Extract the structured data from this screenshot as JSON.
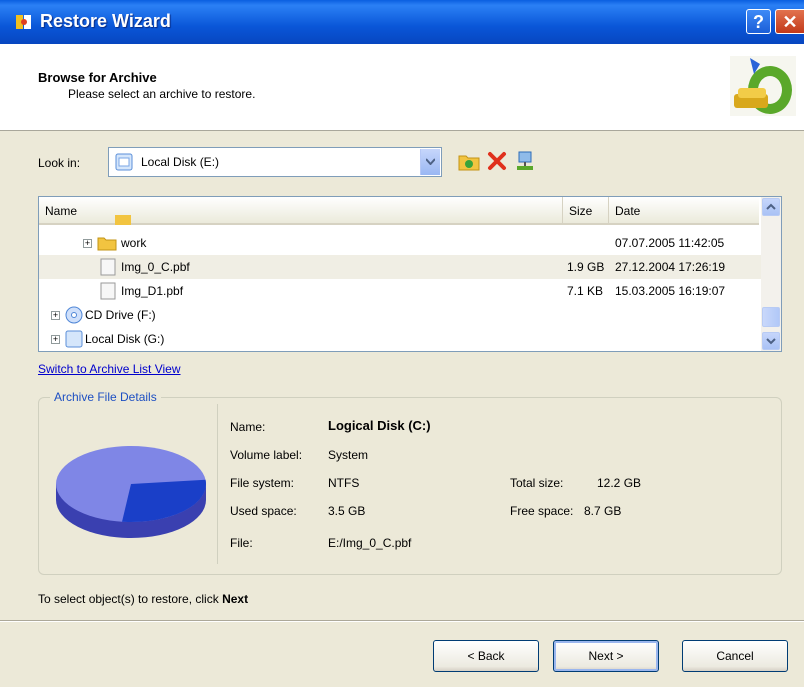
{
  "window": {
    "title": "Restore Wizard",
    "help_label": "?",
    "close_label": "✕"
  },
  "header": {
    "title": "Browse for Archive",
    "subtitle": "Please select an archive to restore."
  },
  "lookin": {
    "label": "Look in:",
    "value": "Local Disk (E:)"
  },
  "toolbar": {
    "icons": [
      "new-folder-icon",
      "delete-icon",
      "network-icon"
    ]
  },
  "tree": {
    "columns": {
      "name": "Name",
      "size": "Size",
      "date": "Date"
    },
    "rows": [
      {
        "name": "work",
        "size": "",
        "date": "07.07.2005 11:42:05"
      },
      {
        "name": "Img_0_C.pbf",
        "size": "1.9 GB",
        "date": "27.12.2004 17:26:19"
      },
      {
        "name": "Img_D1.pbf",
        "size": "7.1 KB",
        "date": "15.03.2005 16:19:07"
      },
      {
        "name": "CD Drive (F:)",
        "size": "",
        "date": ""
      },
      {
        "name": "Local Disk (G:)",
        "size": "",
        "date": ""
      }
    ]
  },
  "switch_link": "Switch to Archive List View",
  "details": {
    "group_title": "Archive File Details",
    "name_label": "Name:",
    "name_value": "Logical Disk (C:)",
    "volume_label": "Volume label:",
    "volume_value": "System",
    "fs_label": "File system:",
    "fs_value": "NTFS",
    "used_label": "Used space:",
    "used_value": "3.5 GB",
    "file_label": "File:",
    "file_value": "E:/Img_0_C.pbf",
    "total_label": "Total size:",
    "total_value": "12.2 GB",
    "free_label": "Free space:",
    "free_value": "8.7 GB",
    "colors": {
      "used": "#1a3fc8",
      "free": "#7f86e6"
    }
  },
  "hint": {
    "text": "To select object(s) to restore, click",
    "bold": "Next"
  },
  "buttons": {
    "back": "< Back",
    "next": "Next >",
    "cancel": "Cancel"
  }
}
